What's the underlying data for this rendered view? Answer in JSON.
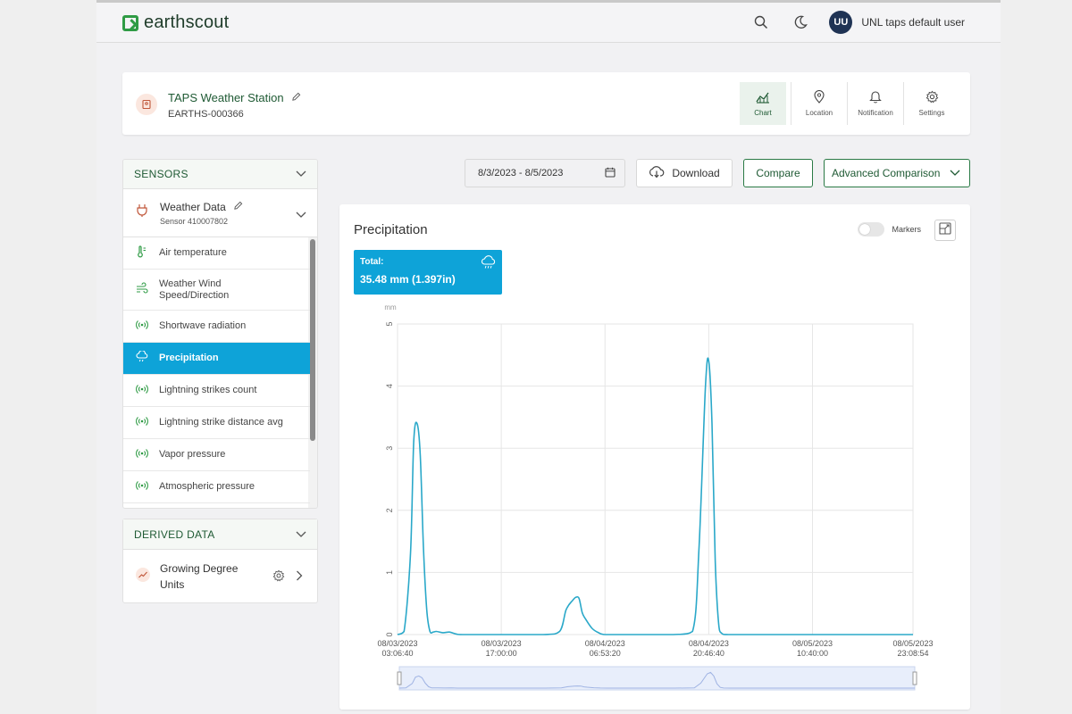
{
  "app": {
    "brand": "earthscout",
    "user_initials": "UU",
    "user_name": "UNL taps default user"
  },
  "station": {
    "name": "TAPS Weather Station",
    "id": "EARTHS-000366",
    "tabs": [
      "Chart",
      "Location",
      "Notification",
      "Settings"
    ],
    "active_tab": "Chart"
  },
  "sensors": {
    "title": "SENSORS",
    "group_name": "Weather Data",
    "group_sub": "Sensor 410007802",
    "items": [
      {
        "label": "Air temperature",
        "icon": "thermometer-icon"
      },
      {
        "label": "Weather Wind Speed/Direction",
        "icon": "wind-icon"
      },
      {
        "label": "Shortwave radiation",
        "icon": "signal-icon"
      },
      {
        "label": "Precipitation",
        "icon": "rain-cloud-icon",
        "active": true
      },
      {
        "label": "Lightning strikes count",
        "icon": "signal-icon"
      },
      {
        "label": "Lightning strike distance avg",
        "icon": "signal-icon"
      },
      {
        "label": "Vapor pressure",
        "icon": "signal-icon"
      },
      {
        "label": "Atmospheric pressure",
        "icon": "signal-icon"
      }
    ]
  },
  "derived": {
    "title": "DERIVED DATA",
    "item": "Growing Degree Units"
  },
  "toolbar": {
    "date_range": "8/3/2023 - 8/5/2023",
    "download": "Download",
    "compare": "Compare",
    "advanced": "Advanced Comparison"
  },
  "chart": {
    "title": "Precipitation",
    "markers_label": "Markers",
    "markers_on": false,
    "total_label": "Total:",
    "total_value": "35.48 mm  (1.397in)",
    "accent": "#0ea3d8",
    "line_color": "#2aa8c9"
  },
  "chart_data": {
    "type": "line",
    "ylabel": "mm",
    "ylim": [
      0,
      5
    ],
    "yticks": [
      {
        "value": 0,
        "label": "0"
      },
      {
        "value": 1,
        "label": "1"
      },
      {
        "value": 2,
        "label": "2"
      },
      {
        "value": 3,
        "label": "3"
      },
      {
        "value": 4,
        "label": "4"
      },
      {
        "value": 5,
        "label": "5"
      }
    ],
    "xlim": [
      0,
      159
    ],
    "xticks": [
      {
        "value": 0,
        "line1": "08/03/2023",
        "line2": "03:06:40"
      },
      {
        "value": 32,
        "line1": "08/03/2023",
        "line2": "17:00:00"
      },
      {
        "value": 64,
        "line1": "08/04/2023",
        "line2": "06:53:20"
      },
      {
        "value": 96,
        "line1": "08/04/2023",
        "line2": "20:46:40"
      },
      {
        "value": 128,
        "line1": "08/05/2023",
        "line2": "10:40:00"
      },
      {
        "value": 159,
        "line1": "08/05/2023",
        "line2": "23:08:54"
      }
    ],
    "series": [
      {
        "x": [
          0,
          2,
          4,
          5,
          6,
          7,
          8,
          9,
          10,
          11,
          12,
          14,
          16,
          18,
          20,
          30,
          45,
          50,
          52,
          54,
          55,
          56,
          57,
          58,
          60,
          62,
          64,
          70,
          85,
          91,
          93,
          95,
          96,
          97,
          98,
          99,
          100,
          102,
          110,
          130,
          159
        ],
        "y": [
          0,
          0.05,
          1.3,
          3.1,
          3.4,
          2.9,
          1.4,
          0.4,
          0.05,
          0.04,
          0.05,
          0.03,
          0.04,
          0.01,
          0,
          0,
          0,
          0.05,
          0.4,
          0.55,
          0.6,
          0.58,
          0.35,
          0.25,
          0.1,
          0.03,
          0,
          0,
          0,
          0.05,
          1.4,
          4.0,
          4.4,
          3.4,
          1.2,
          0.2,
          0.02,
          0,
          0,
          0,
          0
        ]
      }
    ]
  }
}
